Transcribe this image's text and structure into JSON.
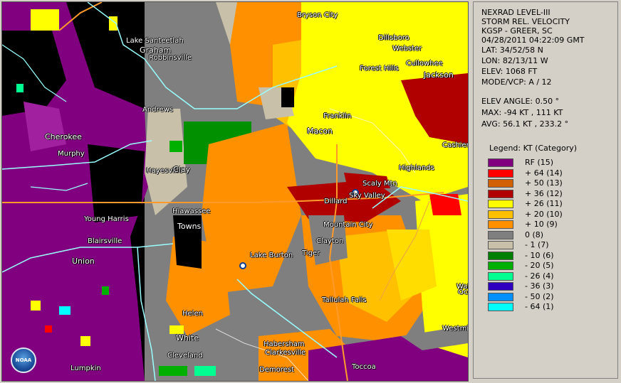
{
  "product": {
    "title": "NEXRAD LEVEL-III",
    "product_name": "STORM REL. VELOCITY",
    "station": "KGSP - GREER, SC",
    "datetime": "04/28/2011 04:22:09 GMT",
    "lat": "LAT: 34/52/58 N",
    "lon": "LON: 82/13/11 W",
    "elev": "ELEV: 1068 FT",
    "mode_vcp": "MODE/VCP: A / 12",
    "elev_angle": "ELEV ANGLE: 0.50 °",
    "max": "MAX: -94 KT , 111 KT",
    "avg": "AVG: 56.1 KT , 233.2 °"
  },
  "legend": {
    "title": "Legend: KT (Category)",
    "entries": [
      {
        "label": "RF  (15)",
        "color": "#800080"
      },
      {
        "label": "+ 64  (14)",
        "color": "#ff0000"
      },
      {
        "label": "+ 50  (13)",
        "color": "#d06000"
      },
      {
        "label": "+ 36  (12)",
        "color": "#b00000"
      },
      {
        "label": "+ 26  (11)",
        "color": "#ffff00"
      },
      {
        "label": "+ 20  (10)",
        "color": "#ffc000"
      },
      {
        "label": "+ 10  (9)",
        "color": "#ff9000"
      },
      {
        "label": "0  (8)",
        "color": "#7f7f7f"
      },
      {
        "label": "- 1  (7)",
        "color": "#c8c0a8"
      },
      {
        "label": "- 10  (6)",
        "color": "#008000"
      },
      {
        "label": "- 20  (5)",
        "color": "#00b000"
      },
      {
        "label": "- 26  (4)",
        "color": "#00ff90"
      },
      {
        "label": "- 36  (3)",
        "color": "#3000c0"
      },
      {
        "label": "- 50  (2)",
        "color": "#0090ff"
      },
      {
        "label": "- 64  (1)",
        "color": "#00ffff"
      }
    ]
  },
  "map": {
    "cities": [
      "Bryson City",
      "Dillsboro",
      "Webster",
      "Lake Santeetlah",
      "Graham",
      "Robbinsville",
      "Forest Hills",
      "Cullowhee",
      "Jackson",
      "Andrews",
      "Franklin",
      "Macon",
      "Cherokee",
      "Murphy",
      "Cashiers",
      "Highlands",
      "Hayesville",
      "Clay",
      "Scaly Mtn",
      "Sky Valley",
      "Dillard",
      "Hiawassee",
      "Young Harris",
      "Towns",
      "Mountain City",
      "Clayton",
      "Blairsville",
      "Union",
      "Lake Burton",
      "Tiger",
      "Tallulah Falls",
      "Helen",
      "White",
      "Cleveland",
      "Habersham",
      "Clarkesville",
      "Demorest",
      "Toccoa",
      "Westmi",
      "Wal",
      "Oco",
      "Lumpkin"
    ],
    "logo_text": "NOAA"
  }
}
